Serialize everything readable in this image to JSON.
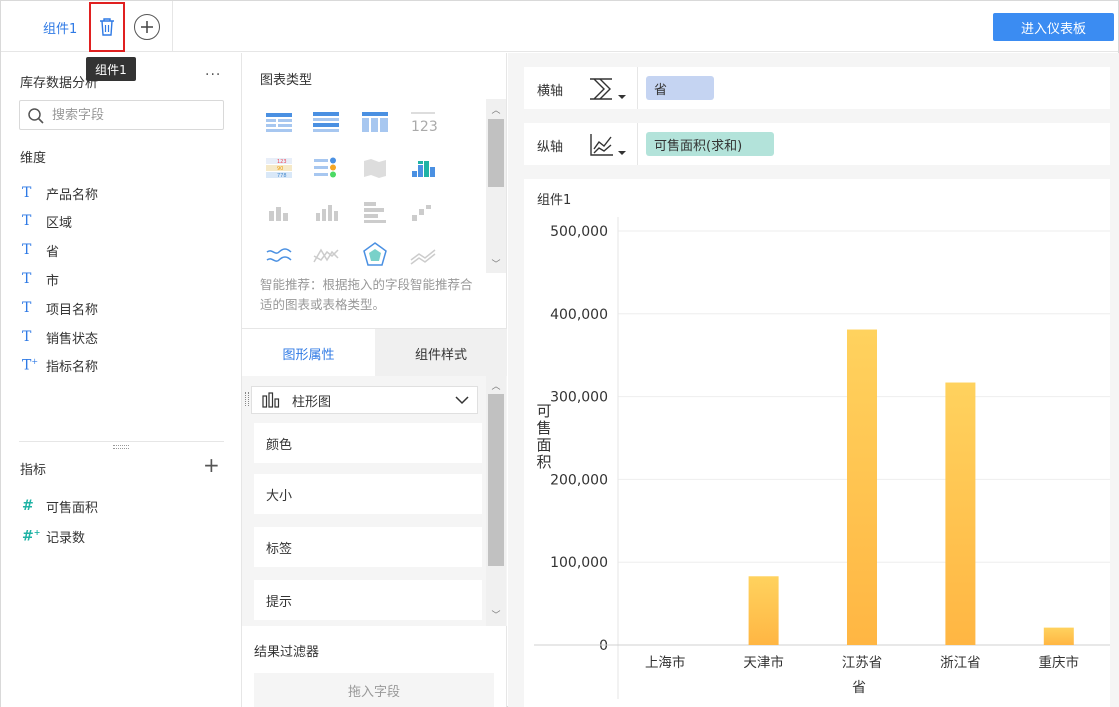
{
  "topbar": {
    "tab_label": "组件1",
    "tooltip": "组件1",
    "enter_dashboard": "进入仪表板"
  },
  "left": {
    "dataset_title": "库存数据分析",
    "more": "···",
    "search_placeholder": "搜索字段",
    "dimension_title": "维度",
    "dimensions": [
      "产品名称",
      "区域",
      "省",
      "市",
      "项目名称",
      "销售状态",
      "指标名称"
    ],
    "metric_title": "指标",
    "metrics": [
      "可售面积",
      "记录数"
    ]
  },
  "middle": {
    "chart_type_title": "图表类型",
    "smart_hint": "智能推荐：根据拖入的字段智能推荐合适的图表或表格类型。",
    "tab_graphic": "图形属性",
    "tab_style": "组件样式",
    "chart_type_selected": "柱形图",
    "props": [
      "颜色",
      "大小",
      "标签",
      "提示"
    ],
    "filter_title": "结果过滤器",
    "filter_drop": "拖入字段"
  },
  "right": {
    "x_axis_label": "横轴",
    "x_axis_field": "省",
    "y_axis_label": "纵轴",
    "y_axis_field": "可售面积(求和)",
    "colors": {
      "x_pill": "#c5d4f2",
      "y_pill": "#b3e3da",
      "bar_top": "#ffd25e",
      "bar_bottom": "#ffb643",
      "accent": "#2f7ae5"
    }
  },
  "chart_data": {
    "type": "bar",
    "title": "组件1",
    "categories": [
      "上海市",
      "天津市",
      "江苏省",
      "浙江省",
      "重庆市"
    ],
    "values": [
      0,
      83000,
      381000,
      317000,
      21000
    ],
    "xlabel": "省",
    "ylabel": "可售面积",
    "ylim": [
      0,
      500000
    ],
    "yticks": [
      "0",
      "100,000",
      "200,000",
      "300,000",
      "400,000",
      "500,000"
    ],
    "grid": true
  }
}
